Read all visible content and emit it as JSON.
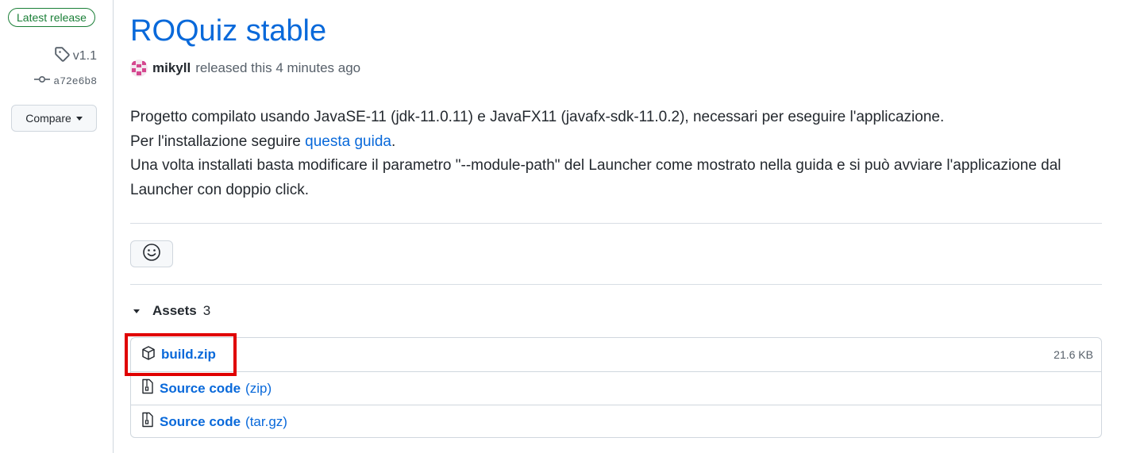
{
  "sidebar": {
    "badge": "Latest release",
    "tag": "v1.1",
    "commit": "a72e6b8",
    "compare_label": "Compare",
    "icons": {
      "tag": "tag-icon",
      "commit": "git-commit-icon",
      "caret": "caret-down-icon"
    }
  },
  "release": {
    "title": "ROQuiz stable",
    "author": "mikyll",
    "released_text": "released this 4 minutes ago",
    "body": {
      "line1": "Progetto compilato usando JavaSE-11 (jdk-11.0.11) e JavaFX11 (javafx-sdk-11.0.2), necessari per eseguire l'applicazione.",
      "line2_prefix": "Per l'installazione seguire ",
      "line2_link": "questa guida",
      "line2_suffix": ".",
      "line3": "Una volta installati basta modificare il parametro \"--module-path\" del Launcher come mostrato nella guida e si può avviare l'applicazione dal Launcher con doppio click."
    },
    "reaction_icon": "smiley-icon"
  },
  "assets": {
    "label": "Assets",
    "count": "3",
    "items": [
      {
        "name": "build.zip",
        "suffix": "",
        "size": "21.6 KB",
        "icon": "package-icon"
      },
      {
        "name": "Source code",
        "suffix": "(zip)",
        "size": "",
        "icon": "file-zip-icon"
      },
      {
        "name": "Source code",
        "suffix": "(tar.gz)",
        "size": "",
        "icon": "file-zip-icon"
      }
    ]
  },
  "colors": {
    "link": "#0969da",
    "badge_green": "#1a7f37",
    "highlight": "#e00000",
    "muted": "#57606a"
  }
}
